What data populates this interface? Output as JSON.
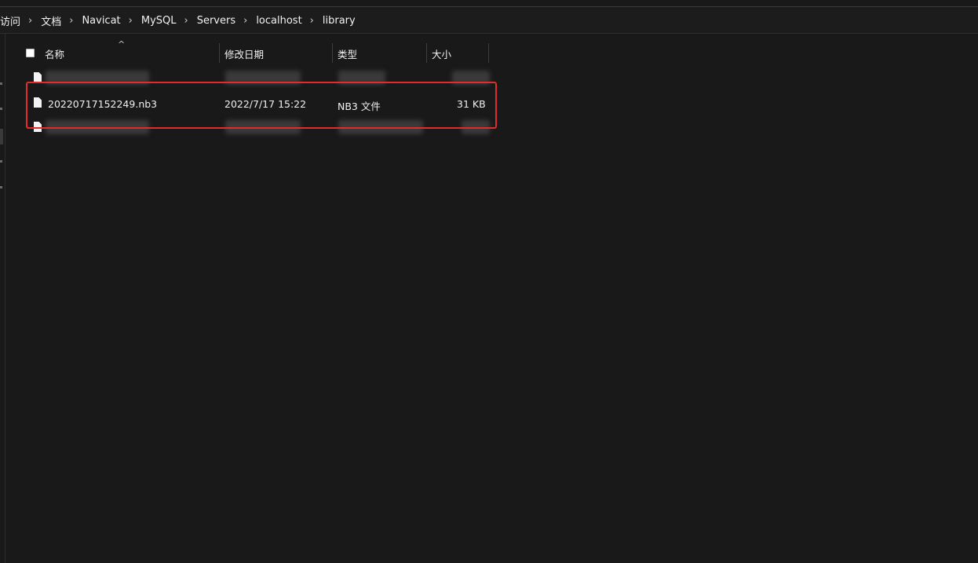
{
  "breadcrumb": {
    "items": [
      "访问",
      "文档",
      "Navicat",
      "MySQL",
      "Servers",
      "localhost",
      "library"
    ],
    "separator": "›"
  },
  "columns": {
    "name": "名称",
    "modified": "修改日期",
    "type": "类型",
    "size": "大小"
  },
  "files": [
    {
      "name": "20220717152249.nb3",
      "modified": "2022/7/17 15:22",
      "type": "NB3 文件",
      "size": "31 KB"
    }
  ],
  "colors": {
    "background": "#191919",
    "highlight_border": "#e22c2c",
    "text": "#f0f0f0"
  }
}
